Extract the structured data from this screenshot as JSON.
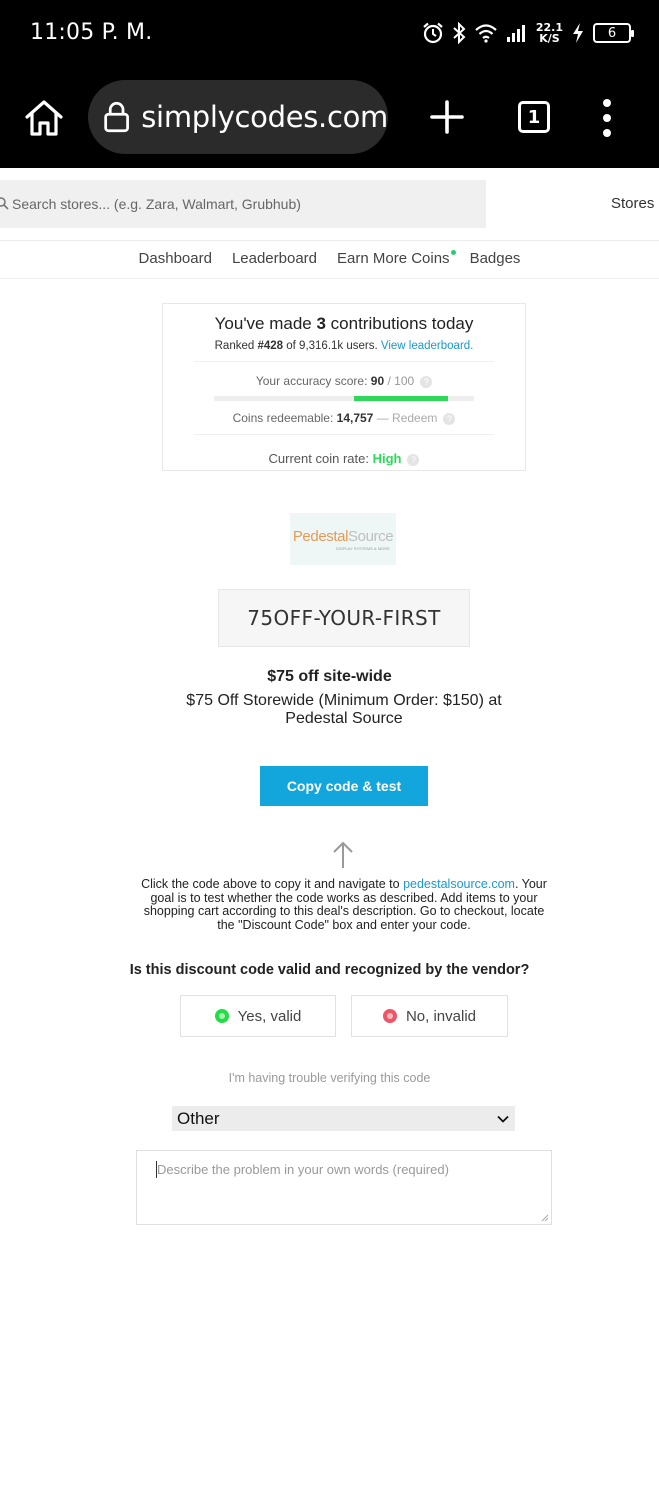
{
  "status_bar": {
    "time": "11:05 P. M.",
    "net_speed_value": "22.1",
    "net_speed_unit": "K/S",
    "battery": "6",
    "icons": [
      "alarm-icon",
      "bluetooth-icon",
      "wifi-icon",
      "signal-icon",
      "charging-icon",
      "battery-icon"
    ]
  },
  "browser": {
    "url": "simplycodes.com",
    "tab_count": "1"
  },
  "header": {
    "search_placeholder": "Search stores... (e.g. Zara, Walmart, Grubhub)",
    "stores_label": "Stores"
  },
  "nav": {
    "items": [
      "Dashboard",
      "Leaderboard",
      "Earn More Coins",
      "Badges"
    ]
  },
  "stats": {
    "made_prefix": "You've made ",
    "contributions": "3",
    "made_suffix": " contributions today",
    "ranked_prefix": "Ranked ",
    "rank": "#428",
    "ranked_mid": " of 9,316.1k users. ",
    "leaderboard_link": "View leaderboard.",
    "accuracy_label": "Your accuracy score: ",
    "accuracy_value": "90",
    "accuracy_max": " / 100",
    "accuracy_fraction": 0.9,
    "coins_label": "Coins redeemable: ",
    "coins_value": "14,757",
    "redeem_label": " — Redeem",
    "rate_label": "Current coin rate: ",
    "rate_value": "High",
    "help_glyph": "?"
  },
  "store": {
    "logo_part1": "Pedestal",
    "logo_part2": "Source",
    "logo_tagline": "DISPLAY SYSTEMS & MORE"
  },
  "deal": {
    "code": "75OFF-YOUR-FIRST",
    "title": "$75 off site-wide",
    "description": "$75 Off Storewide (Minimum Order: $150) at Pedestal Source",
    "copy_button": "Copy code & test",
    "instructions_before": "Click the code above to copy it and navigate to ",
    "instructions_link": "pedestalsource.com",
    "instructions_after": ". Your goal is to test whether the code works as described. Add items to your shopping cart according to this deal's description. Go to checkout, locate the \"Discount Code\" box and enter your code."
  },
  "verify": {
    "question": "Is this discount code valid and recognized by the vendor?",
    "yes_label": "Yes, valid",
    "no_label": "No, invalid",
    "yes_color": "#22dd44",
    "no_color": "#ee5566",
    "trouble_text": "I'm having trouble verifying this code",
    "select_value": "Other",
    "textarea_placeholder": "Describe the problem in your own words (required)"
  },
  "colors": {
    "accent": "#13a6dc",
    "link": "#1b98c9",
    "success": "#2fd75a"
  }
}
